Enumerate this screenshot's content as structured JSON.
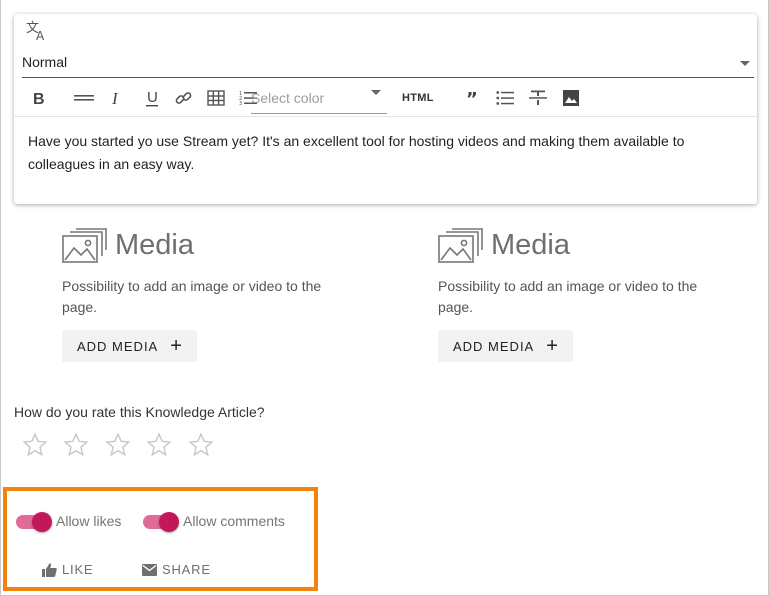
{
  "editor": {
    "block_format": "Normal",
    "color_placeholder": "Select color",
    "html_label": "HTML",
    "toolbar_icons": [
      "bold-icon",
      "horizontal-rule-icon",
      "italic-icon",
      "underline-icon",
      "link-icon",
      "table-icon",
      "ordered-list-icon",
      "quote-icon",
      "bullet-list-icon",
      "strikethrough-icon",
      "image-icon"
    ],
    "content": "Have you started yo use Stream yet? It's an excellent tool for hosting videos and making them available to colleagues in an easy way."
  },
  "media_blocks": [
    {
      "title": "Media",
      "description": "Possibility to add an image or video to the page.",
      "button_label": "ADD MEDIA"
    },
    {
      "title": "Media",
      "description": "Possibility to add an image or video to the page.",
      "button_label": "ADD MEDIA"
    }
  ],
  "rating": {
    "question": "How do you rate this Knowledge Article?",
    "max_stars": 5,
    "selected": 0
  },
  "settings": {
    "allow_likes": {
      "label": "Allow likes",
      "on": true
    },
    "allow_comments": {
      "label": "Allow comments",
      "on": true
    }
  },
  "actions": {
    "like_label": "LIKE",
    "share_label": "SHARE"
  },
  "colors": {
    "toggle_track": "#e06b98",
    "toggle_thumb": "#c2185b",
    "highlight_border": "#f5820f"
  }
}
